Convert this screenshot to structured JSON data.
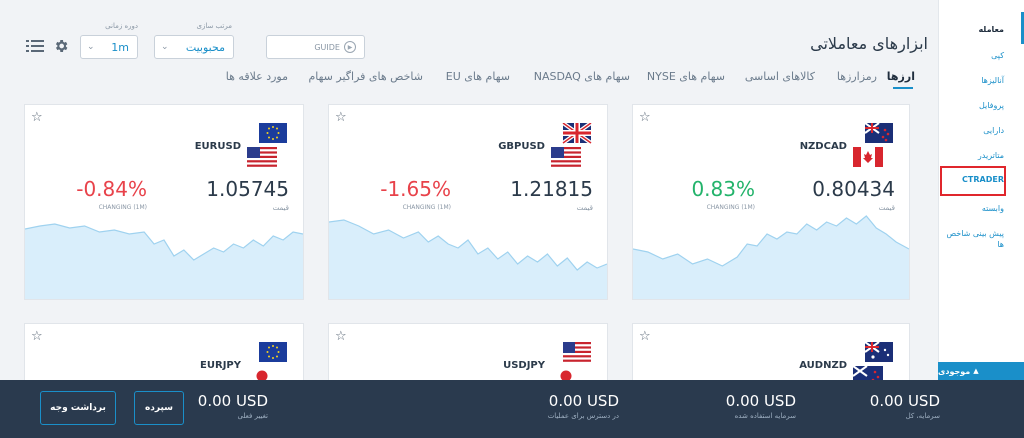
{
  "sidebar": {
    "items": [
      {
        "label": "معامله"
      },
      {
        "label": "کپی"
      },
      {
        "label": "آنالیزها"
      },
      {
        "label": "پروفایل"
      },
      {
        "label": "دارایی"
      },
      {
        "label": "متاتریدر"
      },
      {
        "label": "CTRADER"
      },
      {
        "label": "وابسته"
      },
      {
        "label": "پیش بینی شاخص ها"
      }
    ],
    "available_label": "موجودی"
  },
  "header": {
    "title": "ابزارهای معاملاتی",
    "guide_label": "GUIDE",
    "sort_label": "مرتب سازی",
    "sort_value": "محبوبیت",
    "period_label": "دوره زمانی",
    "period_value": "1m"
  },
  "tabs": [
    {
      "label": "ارزها"
    },
    {
      "label": "رمزارزها"
    },
    {
      "label": "کالاهای اساسی"
    },
    {
      "label": "سهام های NYSE"
    },
    {
      "label": "سهام های NASDAQ"
    },
    {
      "label": "سهام های EU"
    },
    {
      "label": "شاخص های فراگیر سهام"
    },
    {
      "label": "مورد علاقه ها"
    }
  ],
  "cards": [
    {
      "symbol": "NZDCAD",
      "price": "0.80434",
      "price_label": "قیمت",
      "change": "0.83%",
      "change_label": "CHANGING (1M)",
      "flags": [
        "nz-flag-icon",
        "ca-flag-icon"
      ]
    },
    {
      "symbol": "GBPUSD",
      "price": "1.21815",
      "price_label": "قیمت",
      "change": "-1.65%",
      "change_label": "CHANGING (1M)",
      "flags": [
        "uk-flag-icon",
        "us-flag-icon"
      ]
    },
    {
      "symbol": "EURUSD",
      "price": "1.05745",
      "price_label": "قیمت",
      "change": "-0.84%",
      "change_label": "CHANGING (1M)",
      "flags": [
        "eu-flag-icon",
        "us-flag-icon"
      ]
    },
    {
      "symbol": "AUDNZD",
      "flags": [
        "au-flag-icon",
        "nz-flag-icon"
      ]
    },
    {
      "symbol": "USDJPY",
      "flags": [
        "us-flag-icon",
        "jp-flag-icon"
      ]
    },
    {
      "symbol": "EURJPY",
      "flags": [
        "eu-flag-icon",
        "jp-flag-icon"
      ]
    }
  ],
  "bottom": {
    "balance": {
      "amount": "0.00 USD",
      "label": "سرمایه، کل"
    },
    "margin_used": {
      "amount": "0.00 USD",
      "label": "سرمایه استفاده شده"
    },
    "available_for_trades": {
      "amount": "0.00 USD",
      "label": "در دسترس برای عملیات"
    },
    "current_change": {
      "amount": "0.00 USD",
      "label": "تغییر فعلی"
    },
    "deposit_label": "سپرده",
    "withdraw_label": "برداشت وجه"
  },
  "colors": {
    "accent": "#1a8fc9",
    "positive": "#23b36b",
    "negative": "#e8424a",
    "bottom_bar": "#2a3a4e",
    "highlight_box": "#e0262c"
  }
}
